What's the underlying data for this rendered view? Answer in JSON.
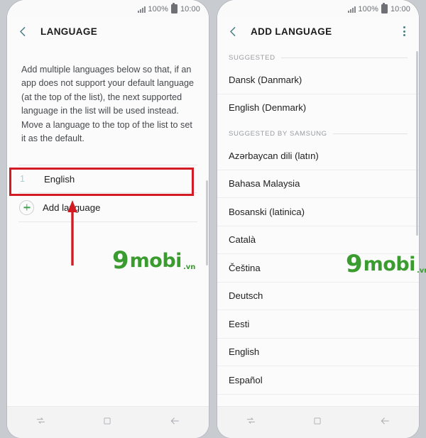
{
  "status_bar": {
    "signal_icon": "signal-bars-icon",
    "battery_text": "100%",
    "battery_icon": "battery-full-icon",
    "time": "10:00"
  },
  "colors": {
    "accent_teal": "#4b7f82",
    "index_teal": "#9fd2d6",
    "plus_green": "#3fa34d",
    "annotation_red": "#d31b24",
    "watermark_green": "#3a9c2f",
    "page_background": "#c8cbd0",
    "screen_background": "#fbfbfb"
  },
  "left_screen": {
    "back_icon": "back-chevron-icon",
    "title": "LANGUAGE",
    "description": "Add multiple languages below so that, if an app does not support your default language (at the top of the list), the next supported language in the list will be used instead. Move a language to the top of the list to set it as the default.",
    "languages": [
      {
        "index": "1",
        "name": "English"
      }
    ],
    "add_language": {
      "icon": "plus-circle-icon",
      "label": "Add language"
    }
  },
  "right_screen": {
    "back_icon": "back-chevron-icon",
    "title": "ADD LANGUAGE",
    "menu_icon": "overflow-menu-icon",
    "sections": [
      {
        "label": "SUGGESTED",
        "items": [
          "Dansk (Danmark)",
          "English (Denmark)"
        ]
      },
      {
        "label": "SUGGESTED BY SAMSUNG",
        "items": [
          "Azərbaycan dili (latın)",
          "Bahasa Malaysia",
          "Bosanski (latinica)",
          "Català",
          "Čeština",
          "Deutsch",
          "Eesti",
          "English",
          "Español"
        ]
      }
    ]
  },
  "nav_bar": {
    "recents_icon": "recent-apps-icon",
    "home_icon": "home-square-icon",
    "back_icon": "back-arrow-icon"
  },
  "watermark": {
    "digit": "9",
    "word": "mobi",
    "tld": ".vn"
  }
}
